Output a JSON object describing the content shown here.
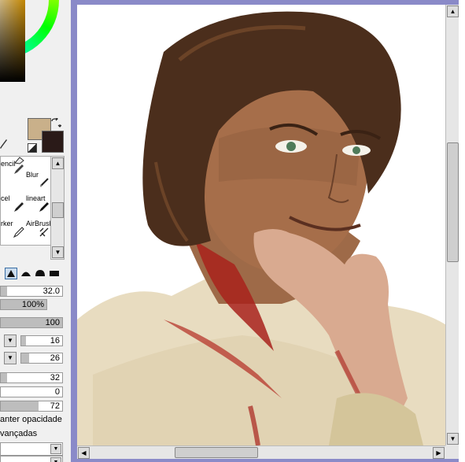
{
  "color_panel": {
    "main_color": "#c9b08a",
    "sub_color": "#2a1a18",
    "swap_icon": "swap-arrows",
    "eyedropper_icon": "eyedropper"
  },
  "tools": [
    {
      "label": "encil",
      "icon": "pencil"
    },
    {
      "label": "Blur",
      "icon": "water-drop"
    },
    {
      "label": "cel",
      "icon": "pencil"
    },
    {
      "label": "lineart",
      "icon": "pen"
    },
    {
      "label": "rker",
      "icon": "marker"
    },
    {
      "label": "AirBrush",
      "icon": "airbrush"
    }
  ],
  "brush": {
    "size": "32.0",
    "min_size": "100%",
    "density": "100",
    "param1": "16",
    "param2": "26",
    "param3": "32",
    "param4": "0",
    "param5": "72",
    "keep_opacity_label": "anter opacidade",
    "advanced_label": "vançadas"
  },
  "canvas": {
    "illustration": "digital painting of a smiling man with dark wavy hair, a hand on his jaw, blood on neck"
  }
}
